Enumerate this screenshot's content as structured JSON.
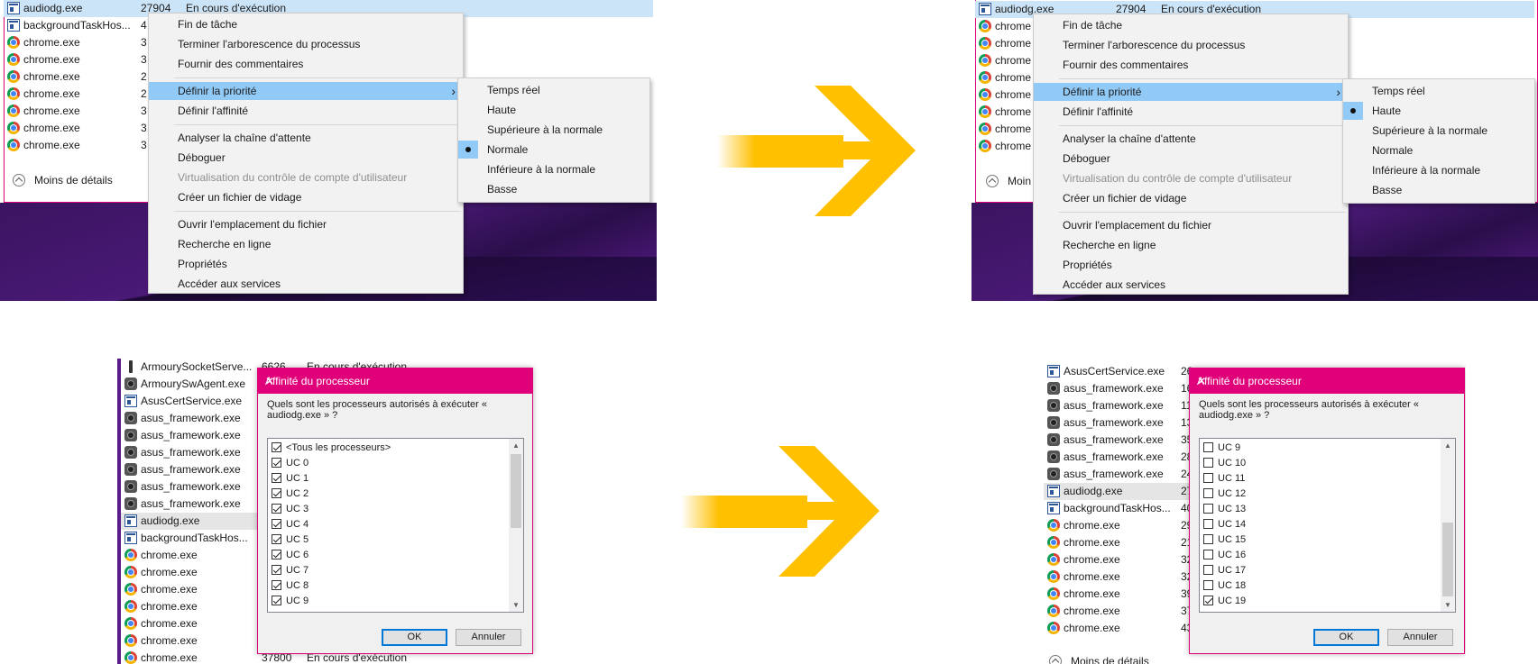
{
  "colors": {
    "accent": "#e0007a",
    "highlight": "#91c9f7",
    "arrow": "#ffc000",
    "selection": "#cce4f7"
  },
  "panel_tl": {
    "selected_row": {
      "name": "audiodg.exe",
      "pid": "27904",
      "status": "En cours d'exécution"
    },
    "rows": [
      {
        "icon": "app-window-icon",
        "name": "backgroundTaskHos...",
        "pid": "4"
      },
      {
        "icon": "chrome-icon",
        "name": "chrome.exe",
        "pid": "3"
      },
      {
        "icon": "chrome-icon",
        "name": "chrome.exe",
        "pid": "3"
      },
      {
        "icon": "chrome-icon",
        "name": "chrome.exe",
        "pid": "2"
      },
      {
        "icon": "chrome-icon",
        "name": "chrome.exe",
        "pid": "2"
      },
      {
        "icon": "chrome-icon",
        "name": "chrome.exe",
        "pid": "3"
      },
      {
        "icon": "chrome-icon",
        "name": "chrome.exe",
        "pid": "3"
      },
      {
        "icon": "chrome-icon",
        "name": "chrome.exe",
        "pid": "3"
      }
    ],
    "less_details": "Moins de détails",
    "submenu": [
      {
        "label": "Temps réel",
        "checked": false
      },
      {
        "label": "Haute",
        "checked": false
      },
      {
        "label": "Supérieure à la normale",
        "checked": false
      },
      {
        "label": "Normale",
        "checked": true
      },
      {
        "label": "Inférieure à la normale",
        "checked": false
      },
      {
        "label": "Basse",
        "checked": false
      }
    ]
  },
  "panel_tr": {
    "selected_row": {
      "name": "audiodg.exe",
      "pid": "27904",
      "status": "En cours d'exécution"
    },
    "rows": [
      {
        "icon": "chrome-icon",
        "name": "chrome"
      },
      {
        "icon": "chrome-icon",
        "name": "chrome"
      },
      {
        "icon": "chrome-icon",
        "name": "chrome"
      },
      {
        "icon": "chrome-icon",
        "name": "chrome"
      },
      {
        "icon": "chrome-icon",
        "name": "chrome"
      },
      {
        "icon": "chrome-icon",
        "name": "chrome"
      },
      {
        "icon": "chrome-icon",
        "name": "chrome"
      },
      {
        "icon": "chrome-icon",
        "name": "chrome"
      }
    ],
    "less_details": "Moin",
    "submenu": [
      {
        "label": "Temps réel",
        "checked": false
      },
      {
        "label": "Haute",
        "checked": true
      },
      {
        "label": "Supérieure à la normale",
        "checked": false
      },
      {
        "label": "Normale",
        "checked": false
      },
      {
        "label": "Inférieure à la normale",
        "checked": false
      },
      {
        "label": "Basse",
        "checked": false
      }
    ]
  },
  "context_menu": {
    "groups": [
      [
        "Fin de tâche",
        "Terminer l'arborescence du processus",
        "Fournir des commentaires"
      ],
      [
        "Définir la priorité",
        "Définir l'affinité"
      ],
      [
        "Analyser la chaîne d'attente",
        "Déboguer",
        "Virtualisation du contrôle de compte d'utilisateur",
        "Créer un fichier de vidage"
      ],
      [
        "Ouvrir l'emplacement du fichier",
        "Recherche en ligne",
        "Propriétés",
        "Accéder aux services"
      ]
    ],
    "highlighted": "Définir la priorité",
    "disabled": "Virtualisation du contrôle de compte d'utilisateur"
  },
  "panel_bl": {
    "rows": [
      {
        "icon": "pill-icon",
        "name": "ArmourySocketServe...",
        "pid": "6626",
        "status": "En cours d'exécution"
      },
      {
        "icon": "asus-icon",
        "name": "ArmourySwAgent.exe"
      },
      {
        "icon": "app-window-icon",
        "name": "AsusCertService.exe"
      },
      {
        "icon": "asus-icon",
        "name": "asus_framework.exe"
      },
      {
        "icon": "asus-icon",
        "name": "asus_framework.exe"
      },
      {
        "icon": "asus-icon",
        "name": "asus_framework.exe"
      },
      {
        "icon": "asus-icon",
        "name": "asus_framework.exe"
      },
      {
        "icon": "asus-icon",
        "name": "asus_framework.exe"
      },
      {
        "icon": "asus-icon",
        "name": "asus_framework.exe"
      },
      {
        "icon": "app-window-icon",
        "name": "audiodg.exe",
        "selected": true
      },
      {
        "icon": "app-window-icon",
        "name": "backgroundTaskHos..."
      },
      {
        "icon": "chrome-icon",
        "name": "chrome.exe"
      },
      {
        "icon": "chrome-icon",
        "name": "chrome.exe"
      },
      {
        "icon": "chrome-icon",
        "name": "chrome.exe"
      },
      {
        "icon": "chrome-icon",
        "name": "chrome.exe"
      },
      {
        "icon": "chrome-icon",
        "name": "chrome.exe"
      },
      {
        "icon": "chrome-icon",
        "name": "chrome.exe"
      },
      {
        "icon": "chrome-icon",
        "name": "chrome.exe",
        "pid": "37800",
        "status": "En cours d'exécution"
      }
    ]
  },
  "panel_br": {
    "rows": [
      {
        "icon": "app-window-icon",
        "name": "AsusCertService.exe",
        "pid": "26"
      },
      {
        "icon": "asus-icon",
        "name": "asus_framework.exe",
        "pid": "16"
      },
      {
        "icon": "asus-icon",
        "name": "asus_framework.exe",
        "pid": "11"
      },
      {
        "icon": "asus-icon",
        "name": "asus_framework.exe",
        "pid": "13"
      },
      {
        "icon": "asus-icon",
        "name": "asus_framework.exe",
        "pid": "35"
      },
      {
        "icon": "asus-icon",
        "name": "asus_framework.exe",
        "pid": "28"
      },
      {
        "icon": "asus-icon",
        "name": "asus_framework.exe",
        "pid": "24"
      },
      {
        "icon": "app-window-icon",
        "name": "audiodg.exe",
        "pid": "27",
        "selected": true
      },
      {
        "icon": "app-window-icon",
        "name": "backgroundTaskHos...",
        "pid": "40"
      },
      {
        "icon": "chrome-icon",
        "name": "chrome.exe",
        "pid": "29"
      },
      {
        "icon": "chrome-icon",
        "name": "chrome.exe",
        "pid": "21"
      },
      {
        "icon": "chrome-icon",
        "name": "chrome.exe",
        "pid": "32"
      },
      {
        "icon": "chrome-icon",
        "name": "chrome.exe",
        "pid": "32"
      },
      {
        "icon": "chrome-icon",
        "name": "chrome.exe",
        "pid": "39"
      },
      {
        "icon": "chrome-icon",
        "name": "chrome.exe",
        "pid": "37"
      },
      {
        "icon": "chrome-icon",
        "name": "chrome.exe",
        "pid": "43"
      }
    ],
    "less_details": "Moins de détails"
  },
  "affinity_dialog": {
    "title": "Affinité du processeur",
    "question": "Quels sont les processeurs autorisés à exécuter « audiodg.exe » ?",
    "ok": "OK",
    "cancel": "Annuler",
    "close": "✕",
    "before_items": [
      {
        "label": "<Tous les processeurs>",
        "checked": true
      },
      {
        "label": "UC 0",
        "checked": true
      },
      {
        "label": "UC 1",
        "checked": true
      },
      {
        "label": "UC 2",
        "checked": true
      },
      {
        "label": "UC 3",
        "checked": true
      },
      {
        "label": "UC 4",
        "checked": true
      },
      {
        "label": "UC 5",
        "checked": true
      },
      {
        "label": "UC 6",
        "checked": true
      },
      {
        "label": "UC 7",
        "checked": true
      },
      {
        "label": "UC 8",
        "checked": true
      },
      {
        "label": "UC 9",
        "checked": true
      }
    ],
    "after_items": [
      {
        "label": "UC 9",
        "checked": false
      },
      {
        "label": "UC 10",
        "checked": false
      },
      {
        "label": "UC 11",
        "checked": false
      },
      {
        "label": "UC 12",
        "checked": false
      },
      {
        "label": "UC 13",
        "checked": false
      },
      {
        "label": "UC 14",
        "checked": false
      },
      {
        "label": "UC 15",
        "checked": false
      },
      {
        "label": "UC 16",
        "checked": false
      },
      {
        "label": "UC 17",
        "checked": false
      },
      {
        "label": "UC 18",
        "checked": false
      },
      {
        "label": "UC 19",
        "checked": true
      }
    ]
  }
}
